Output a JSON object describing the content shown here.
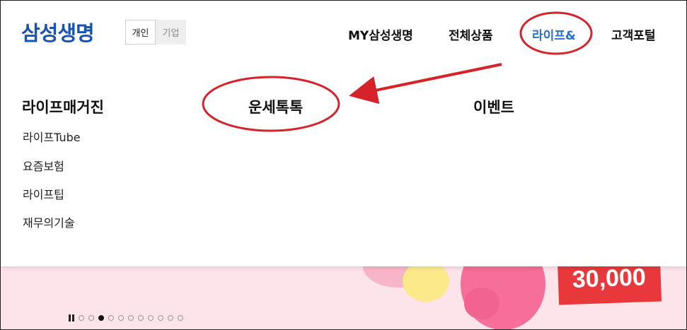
{
  "header": {
    "logo": "삼성생명",
    "segment": [
      "개인",
      "기업"
    ],
    "nav": [
      "MY삼성생명",
      "전체상품",
      "라이프&",
      "고객포털"
    ]
  },
  "menu": {
    "columns": [
      {
        "title": "라이프매거진",
        "items": [
          "라이프Tube",
          "요즘보험",
          "라이프팁",
          "재무의기술"
        ]
      },
      {
        "title": "운세톡톡",
        "items": []
      },
      {
        "title": "이벤트",
        "items": []
      }
    ]
  },
  "banner": {
    "price_text": "30,000",
    "slide_count": 11,
    "active_slide": 3
  },
  "colors": {
    "brand": "#1553b6",
    "active_nav": "#2570d6",
    "annotation": "#d6232a",
    "banner_bg": "#fde4ea"
  },
  "icons": {
    "pause": "pause-icon"
  }
}
